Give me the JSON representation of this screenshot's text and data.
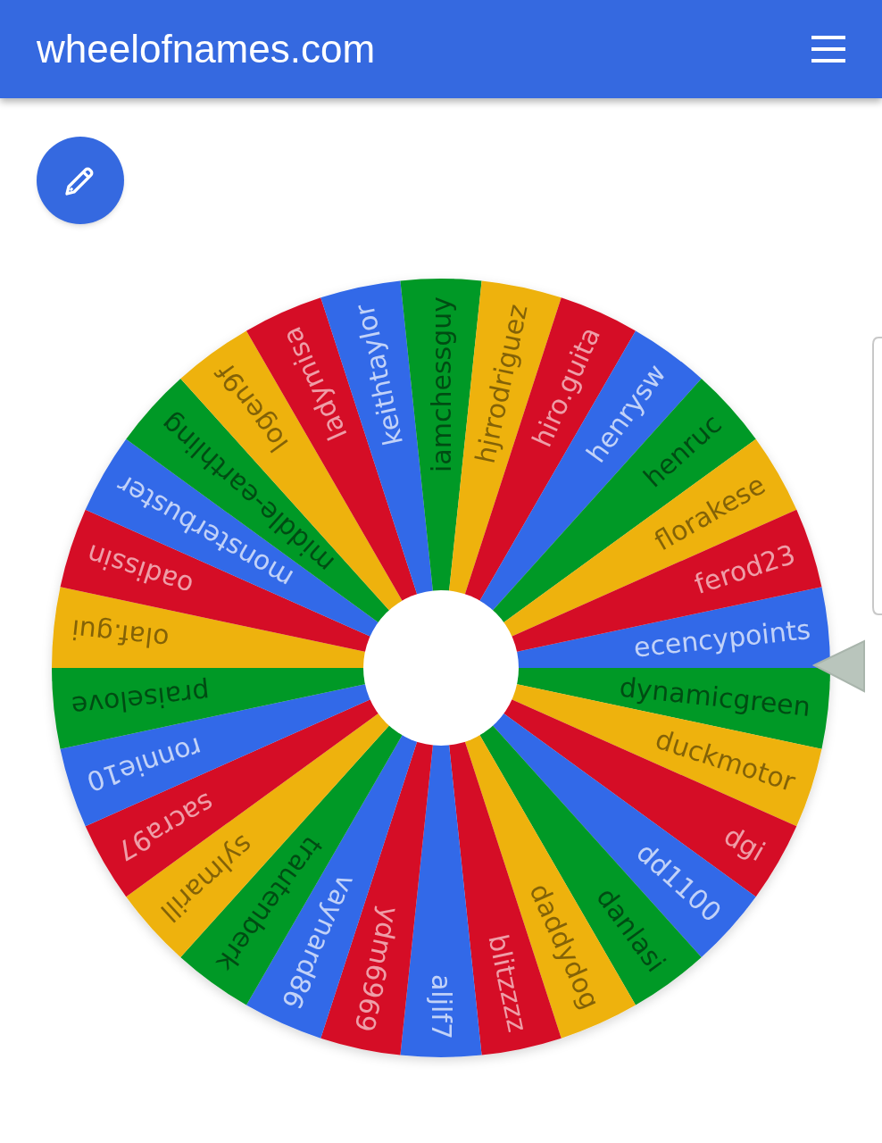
{
  "header": {
    "title": "wheelofnames.com"
  },
  "wheel": {
    "segments": [
      {
        "name": "ecencypoints",
        "color": "#3369e8"
      },
      {
        "name": "dynamicgreen",
        "color": "#009925"
      },
      {
        "name": "duckmotor",
        "color": "#eeb211"
      },
      {
        "name": "dgi",
        "color": "#d50f25"
      },
      {
        "name": "dd1100",
        "color": "#3369e8"
      },
      {
        "name": "danlasi",
        "color": "#009925"
      },
      {
        "name": "daddydog",
        "color": "#eeb211"
      },
      {
        "name": "blitzzzz",
        "color": "#d50f25"
      },
      {
        "name": "aljlf7",
        "color": "#3369e8"
      },
      {
        "name": "ydm6969",
        "color": "#d50f25"
      },
      {
        "name": "vaynard86",
        "color": "#3369e8"
      },
      {
        "name": "trautenberk",
        "color": "#009925"
      },
      {
        "name": "sylmarill",
        "color": "#eeb211"
      },
      {
        "name": "sacra97",
        "color": "#d50f25"
      },
      {
        "name": "ronnie10",
        "color": "#3369e8"
      },
      {
        "name": "praiselove",
        "color": "#009925"
      },
      {
        "name": "olaf.gui",
        "color": "#eeb211"
      },
      {
        "name": "oadissin",
        "color": "#d50f25"
      },
      {
        "name": "monsterbuster",
        "color": "#3369e8"
      },
      {
        "name": "middle-earthling",
        "color": "#009925"
      },
      {
        "name": "logen9f",
        "color": "#eeb211"
      },
      {
        "name": "ladymisa",
        "color": "#d50f25"
      },
      {
        "name": "keithtaylor",
        "color": "#3369e8"
      },
      {
        "name": "iamchessguy",
        "color": "#009925"
      },
      {
        "name": "hjrrodriguez",
        "color": "#eeb211"
      },
      {
        "name": "hiro.guita",
        "color": "#d50f25"
      },
      {
        "name": "henrysw",
        "color": "#3369e8"
      },
      {
        "name": "henruc",
        "color": "#009925"
      },
      {
        "name": "florakese",
        "color": "#eeb211"
      },
      {
        "name": "ferod23",
        "color": "#d50f25"
      }
    ]
  }
}
